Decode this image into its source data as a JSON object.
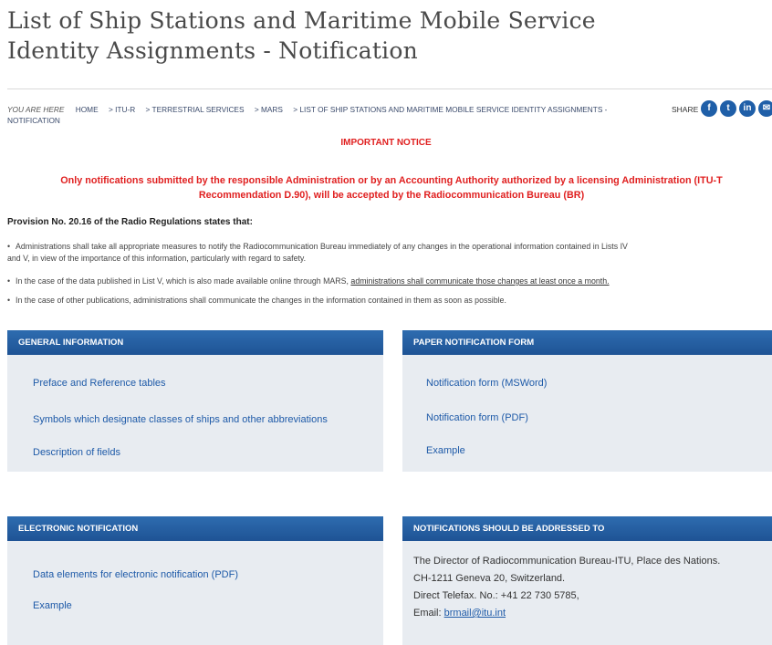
{
  "page_title": "List of Ship Stations and Maritime Mobile Service Identity Assignments - Notification",
  "breadcrumb": {
    "you_are_here": "YOU ARE HERE",
    "items": [
      "HOME",
      "> ITU-R",
      "> TERRESTRIAL SERVICES",
      "> MARS",
      "> LIST OF SHIP STATIONS AND MARITIME MOBILE SERVICE IDENTITY ASSIGNMENTS - NOTIFICATION"
    ]
  },
  "share": {
    "label": "SHARE",
    "icons": [
      {
        "name": "facebook-icon",
        "glyph": "f"
      },
      {
        "name": "twitter-icon",
        "glyph": "t"
      },
      {
        "name": "linkedin-icon",
        "glyph": "in"
      },
      {
        "name": "email-icon",
        "glyph": "✉"
      }
    ]
  },
  "notice": {
    "heading": "IMPORTANT NOTICE",
    "text": "Only notifications submitted by the responsible Administration or by an Accounting Authority authorized by a licensing Administration (ITU-T Recommendation D.90), will be accepted by the Radiocommunication Bureau (BR)"
  },
  "provision": {
    "heading": "Provision No. 20.16 of the Radio Regulations states that:",
    "bullet1_line1": "Administrations shall take all appropriate measures to notify the Radiocommunication Bureau immediately of any changes in the operational information contained in Lists IV",
    "bullet1_line2": "and V, in view of the importance of this information, particularly with regard to safety.",
    "bullet2_text": "In the case of the data published in List V, which is also made available online through MARS,",
    "bullet2_underlined": "administrations shall communicate those changes at least once a month.",
    "bullet3": "In the case of other publications, administrations shall communicate the changes in the information contained in them as soon as possible."
  },
  "panels": {
    "general": {
      "title": "GENERAL INFORMATION",
      "links": [
        "Preface and Reference tables",
        "Symbols which designate classes of ships and other abbreviations",
        "Description of fields"
      ]
    },
    "paper": {
      "title": "PAPER NOTIFICATION FORM",
      "links": [
        "Notification form (MSWord)",
        "Notification form (PDF)",
        "Example"
      ]
    },
    "electronic": {
      "title": "ELECTRONIC NOTIFICATION",
      "links": [
        "Data elements for electronic notification (PDF)",
        "Example"
      ]
    },
    "address": {
      "title": "NOTIFICATIONS SHOULD BE ADDRESSED TO",
      "line1": "The Director of Radiocommunication Bureau-ITU, Place des Nations.",
      "line2": "CH-1211 Geneva 20, Switzerland.",
      "line3": "Direct Telefax. No.: +41 22 730 5785,",
      "email_label": "Email:",
      "email": "brmail@itu.int"
    }
  },
  "colors": {
    "accent": "#1e5aa8",
    "notice": "#e02020",
    "panel_bg": "#e8ecf1",
    "panel_header": "#2563a6"
  }
}
